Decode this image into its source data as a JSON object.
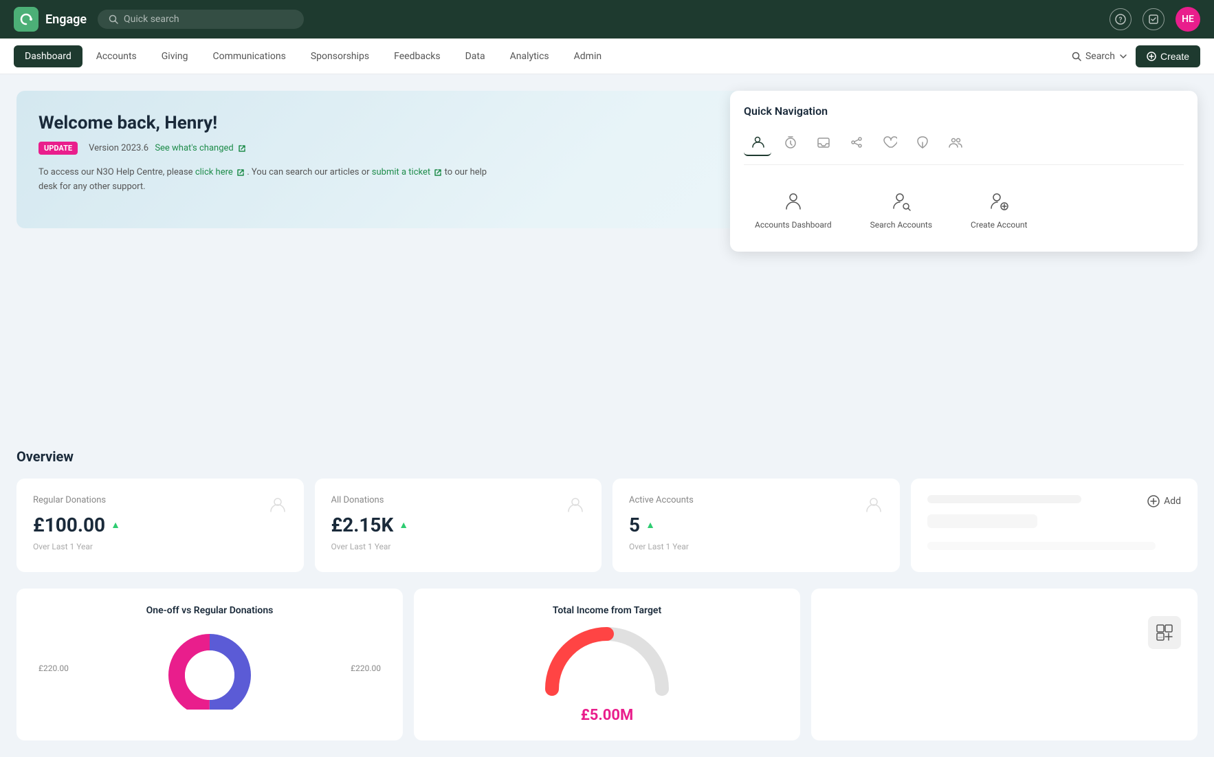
{
  "app": {
    "name": "Engage",
    "logo_letter": "⟳",
    "user_initials": "HE"
  },
  "top_nav": {
    "search_placeholder": "Quick search",
    "help_icon": "?",
    "task_icon": "✓"
  },
  "secondary_nav": {
    "tabs": [
      {
        "id": "dashboard",
        "label": "Dashboard",
        "active": true
      },
      {
        "id": "accounts",
        "label": "Accounts"
      },
      {
        "id": "giving",
        "label": "Giving"
      },
      {
        "id": "communications",
        "label": "Communications"
      },
      {
        "id": "sponsorships",
        "label": "Sponsorships"
      },
      {
        "id": "feedbacks",
        "label": "Feedbacks"
      },
      {
        "id": "data",
        "label": "Data"
      },
      {
        "id": "analytics",
        "label": "Analytics"
      },
      {
        "id": "admin",
        "label": "Admin"
      }
    ],
    "search_label": "Search",
    "create_label": "Create"
  },
  "welcome": {
    "title": "Welcome back, Henry!",
    "badge": "UPDATE",
    "version": "Version 2023.6",
    "see_changes": "See what's changed",
    "help_text_1": "To access our N3O Help Centre, please",
    "click_here": "click here",
    "help_text_2": ". You can search our articles or",
    "submit_ticket": "submit a ticket",
    "help_text_3": "to our help desk for any other support."
  },
  "quick_nav": {
    "title": "Quick Navigation",
    "icon_tabs": [
      {
        "id": "accounts-icon",
        "symbol": "👤",
        "active": true
      },
      {
        "id": "timer-icon",
        "symbol": "⏱"
      },
      {
        "id": "inbox-icon",
        "symbol": "📥"
      },
      {
        "id": "connections-icon",
        "symbol": "🔗"
      },
      {
        "id": "heart-icon",
        "symbol": "♡"
      },
      {
        "id": "leaf-icon",
        "symbol": "🌿"
      },
      {
        "id": "team-icon",
        "symbol": "👥"
      }
    ],
    "items": [
      {
        "id": "accounts-dashboard",
        "label": "Accounts Dashboard",
        "icon": "person-board"
      },
      {
        "id": "search-accounts",
        "label": "Search Accounts",
        "icon": "person-search"
      },
      {
        "id": "create-account",
        "label": "Create Account",
        "icon": "person-add"
      }
    ]
  },
  "overview": {
    "title": "Overview",
    "stats": [
      {
        "id": "regular-donations",
        "label": "Regular Donations",
        "value": "£100.00",
        "trend": "▲",
        "period": "Over Last 1 Year"
      },
      {
        "id": "all-donations",
        "label": "All Donations",
        "value": "£2.15K",
        "trend": "▲",
        "period": "Over Last 1 Year"
      },
      {
        "id": "active-accounts",
        "label": "Active Accounts",
        "value": "5",
        "trend": "▲",
        "period": "Over Last 1 Year"
      },
      {
        "id": "add-widget",
        "label": "",
        "add_label": "Add",
        "is_placeholder": true
      }
    ]
  },
  "charts": [
    {
      "id": "donut-chart",
      "title": "One-off vs Regular Donations",
      "left_label": "£220.00",
      "right_label": "£220.00",
      "donut": {
        "blue_pct": 50,
        "pink_pct": 50,
        "blue_color": "#5b5bd6",
        "pink_color": "#e91e8c"
      }
    },
    {
      "id": "target-chart",
      "title": "Total Income from Target",
      "value": "£5.00M"
    },
    {
      "id": "widget-chart",
      "title": ""
    }
  ]
}
